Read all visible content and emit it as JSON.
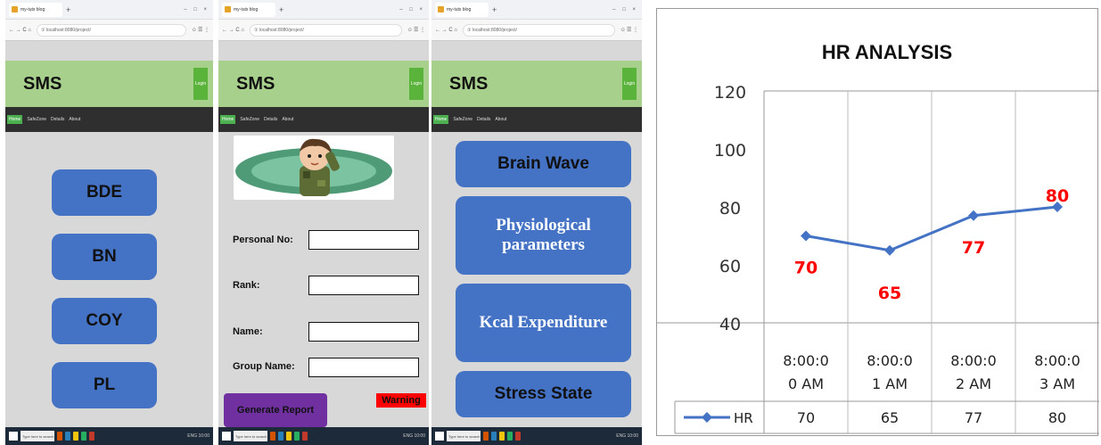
{
  "browser": {
    "tab_label": "my-tuts blog",
    "tab_add": "+",
    "window_controls": "– □ ×",
    "nav_controls": "← → C ⌂",
    "url": "① localhost:8080/project/",
    "addr_tools": "✩ ☰ ⋮"
  },
  "screens": {
    "menu": {
      "app_title": "SMS",
      "login_label": "Login",
      "nav_items": [
        "Home",
        "SafeZone",
        "Details",
        "About"
      ],
      "buttons": [
        "BDE",
        "BN",
        "COY",
        "PL"
      ]
    },
    "profile": {
      "app_title": "SMS",
      "login_label": "Login",
      "nav_items": [
        "Home",
        "SafeZone",
        "Details",
        "About"
      ],
      "fields": [
        {
          "label": "Personal No:",
          "value": ""
        },
        {
          "label": "Rank:",
          "value": ""
        },
        {
          "label": "Name:",
          "value": ""
        },
        {
          "label": "Group Name:",
          "value": ""
        }
      ],
      "generate_label": "Generate Report",
      "warning_label": "Warning"
    },
    "parameters": {
      "app_title": "SMS",
      "login_label": "Login",
      "nav_items": [
        "Home",
        "SafeZone",
        "Details",
        "About"
      ],
      "buttons": [
        "Brain Wave",
        "Physiological parameters",
        "Kcal Expenditure",
        "Stress State"
      ]
    }
  },
  "taskbar": {
    "search_placeholder": "Type here to search",
    "tray": "ENG 10:00"
  },
  "colors": {
    "header": "#a8d08d",
    "nav": "#2f2f2f",
    "button": "#4472c4",
    "purple": "#7030a0",
    "warning": "#ff0000",
    "line": "#4472c4",
    "label": "#ff0000"
  },
  "chart_data": {
    "type": "line",
    "title": "HR ANALYSIS",
    "categories": [
      "8:00:00 AM",
      "8:00:01 AM",
      "8:00:02 AM",
      "8:00:03 AM"
    ],
    "series": [
      {
        "name": "HR",
        "values": [
          70,
          65,
          77,
          80
        ]
      }
    ],
    "ylim": [
      40,
      120
    ],
    "yticks": [
      40,
      60,
      80,
      100,
      120
    ],
    "grid": true,
    "legend": "bottom-left (data table)",
    "xlabel": "",
    "ylabel": ""
  }
}
